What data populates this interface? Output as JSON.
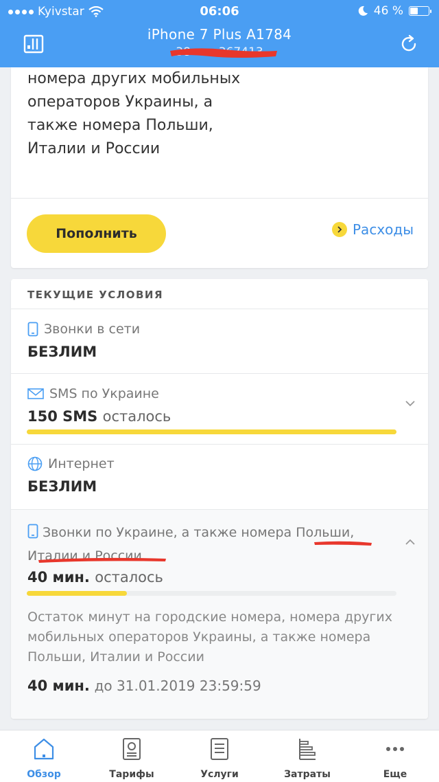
{
  "status_bar": {
    "carrier": "Kyivstar",
    "time": "06:06",
    "battery": "46 %",
    "battery_level": 0.46
  },
  "header": {
    "device": "iPhone 7 Plus A1784",
    "number_visible": "38 ••• 367413",
    "left_icon": "menu-panel-icon",
    "right_icon": "refresh-icon"
  },
  "tariff_description": "номера других мобильных операторов Украины, а также номера Польши, Италии и России",
  "actions": {
    "topup": "Пополнить",
    "expenses": "Расходы"
  },
  "conditions": {
    "title": "ТЕКУЩИЕ УСЛОВИЯ",
    "items": [
      {
        "label": "Звонки в сети",
        "value": "БЕЗЛИМ",
        "icon": "phone-icon"
      },
      {
        "label": "SMS по Украине",
        "value": "150 SMS",
        "suffix": "осталось",
        "icon": "mail-icon",
        "progress": 1.0
      },
      {
        "label": "Интернет",
        "value": "БЕЗЛИМ",
        "icon": "globe-icon"
      },
      {
        "label": "Звонки по Украине, а также номера Польши, Италии и России",
        "value": "40 мин.",
        "suffix": "осталось",
        "icon": "phone-icon",
        "progress": 0.27
      }
    ],
    "detail_note": "Остаток минут на городские номера, номера других мобильных операторов Украины, а также номера Польши, Италии и России",
    "detail_amount": "40 мин.",
    "detail_until": "до 31.01.2019 23:59:59"
  },
  "tabs": [
    {
      "label": "Обзор",
      "icon": "home-icon",
      "active": true
    },
    {
      "label": "Тарифы",
      "icon": "tariffs-icon"
    },
    {
      "label": "Услуги",
      "icon": "services-icon"
    },
    {
      "label": "Затраты",
      "icon": "expenses-icon"
    },
    {
      "label": "Еще",
      "icon": "more-icon"
    }
  ],
  "colors": {
    "header": "#4a9ef3",
    "accent_yellow": "#f7d83a",
    "link_blue": "#3d8ee6",
    "redaction": "#e8372c"
  }
}
